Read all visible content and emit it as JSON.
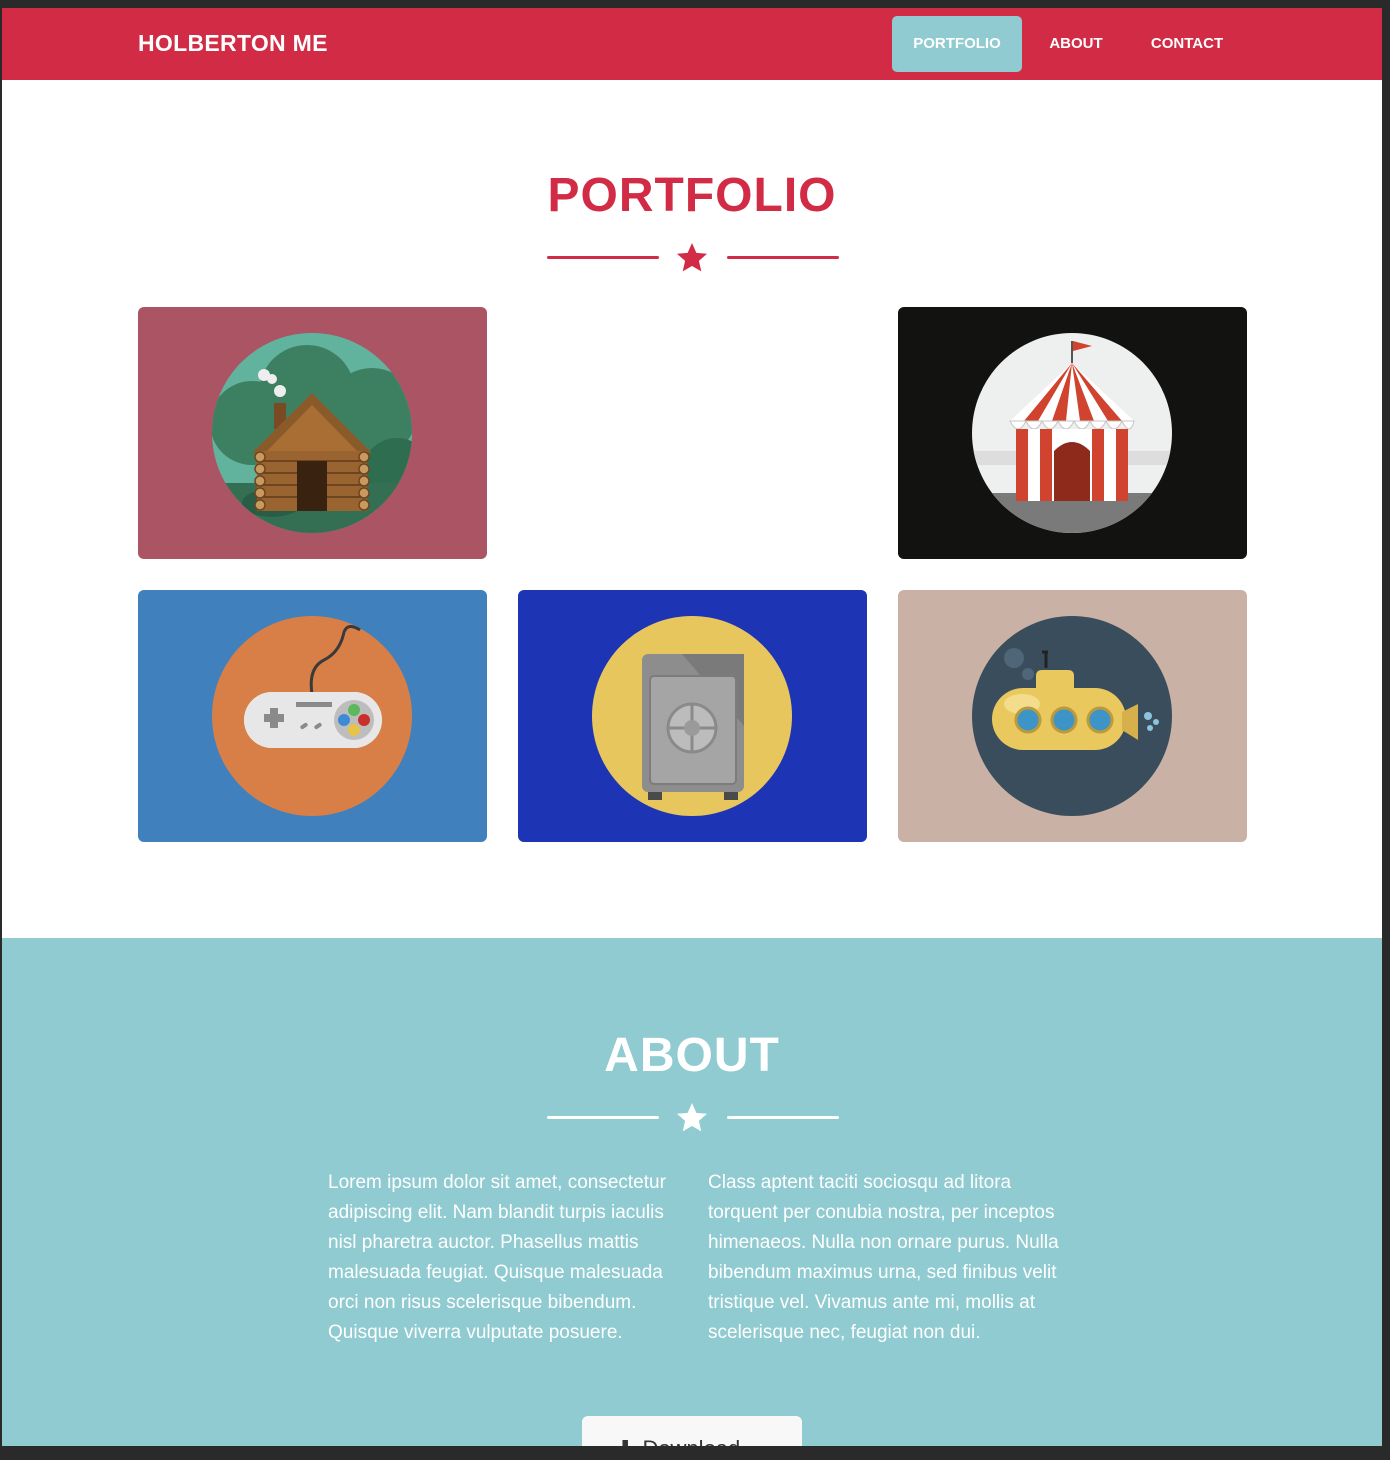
{
  "nav": {
    "brand": "HOLBERTON ME",
    "links": [
      {
        "label": "PORTFOLIO",
        "active": true
      },
      {
        "label": "ABOUT",
        "active": false
      },
      {
        "label": "CONTACT",
        "active": false
      }
    ]
  },
  "portfolio": {
    "title": "PORTFOLIO",
    "tiles": [
      {
        "icon": "log-cabin-icon",
        "bg": "#ab5464"
      },
      {
        "icon": "circus-tent-icon",
        "bg": "#121210"
      },
      {
        "icon": "game-controller-icon",
        "bg": "#3f80bd"
      },
      {
        "icon": "safe-icon",
        "bg": "#1d34b4"
      },
      {
        "icon": "submarine-icon",
        "bg": "#c9b2a5"
      }
    ]
  },
  "about": {
    "title": "ABOUT",
    "column_left": "Lorem ipsum dolor sit amet, consectetur adipiscing elit. Nam blandit turpis iaculis nisl pharetra auctor. Phasellus mattis malesuada feugiat. Quisque malesuada orci non risus scelerisque bibendum. Quisque viverra vulputate posuere.",
    "column_right": "Class aptent taciti sociosqu ad litora torquent per conubia nostra, per inceptos himenaeos. Nulla non ornare purus. Nulla bibendum maximus urna, sed finibus velit tristique vel. Vivamus ante mi, mollis at scelerisque nec, feugiat non dui.",
    "download_label": "Download"
  },
  "colors": {
    "primary": "#d12b45",
    "accent": "#8fcbd1"
  }
}
